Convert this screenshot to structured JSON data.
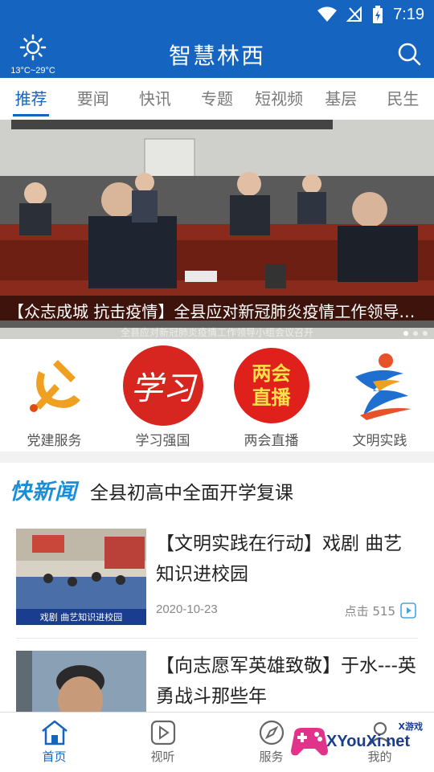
{
  "status": {
    "time": "7:19"
  },
  "header": {
    "weather_temp": "13°C~29°C",
    "title": "智慧林西"
  },
  "tabs": [
    "推荐",
    "要闻",
    "快讯",
    "专题",
    "短视频",
    "基层",
    "民生"
  ],
  "banner": {
    "caption": "【众志成城 抗击疫情】全县应对新冠肺炎疫情工作领导…",
    "subtitle": "全县应对新冠肺炎疫情工作领导小组会议召开"
  },
  "quick_links": [
    {
      "label": "党建服务",
      "icon": "party-emblem-icon"
    },
    {
      "label": "学习强国",
      "icon": "xuexi-icon",
      "icon_text": "学习"
    },
    {
      "label": "两会直播",
      "icon": "live-icon",
      "icon_text_1": "两会",
      "icon_text_2": "直播"
    },
    {
      "label": "文明实践",
      "icon": "civilization-icon"
    }
  ],
  "flash": {
    "logo": "快新闻",
    "text": "全县初高中全面开学复课"
  },
  "news": [
    {
      "title": "【文明实践在行动】戏剧 曲艺知识进校园",
      "date": "2020-10-23",
      "hits": "点击 515",
      "thumb_caption": "戏剧 曲艺知识进校园"
    },
    {
      "title": "【向志愿军英雄致敬】于水---英勇战斗那些年"
    }
  ],
  "bottom_nav": [
    {
      "label": "首页",
      "icon": "home-icon"
    },
    {
      "label": "视听",
      "icon": "play-icon"
    },
    {
      "label": "服务",
      "icon": "compass-icon"
    },
    {
      "label": "我的",
      "icon": "user-icon"
    }
  ],
  "watermark": {
    "brand": "XYouXi.net",
    "small": "X游戏"
  },
  "colors": {
    "primary": "#1565c0",
    "red": "#d7261f",
    "flash_blue": "#1a8fd8"
  }
}
